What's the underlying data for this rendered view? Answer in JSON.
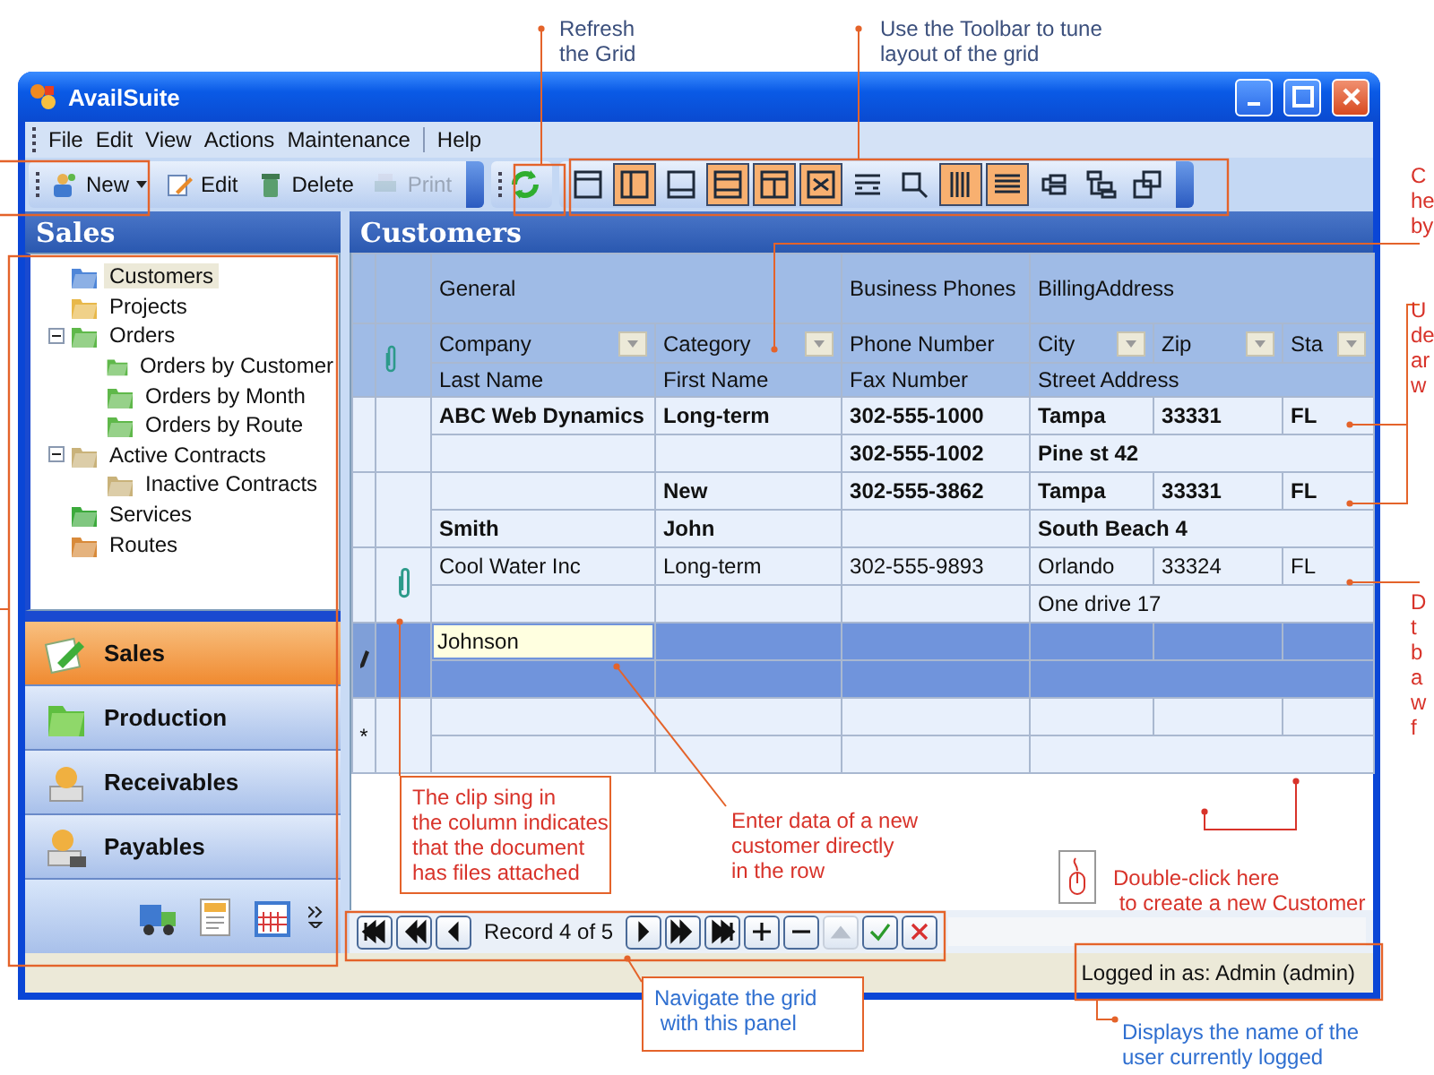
{
  "window": {
    "title": "AvailSuite"
  },
  "menu": [
    {
      "label": "File",
      "separator_before": false
    },
    {
      "label": "Edit",
      "separator_before": false
    },
    {
      "label": "View",
      "separator_before": false
    },
    {
      "label": "Actions",
      "separator_before": false
    },
    {
      "label": "Maintenance",
      "separator_before": false
    },
    {
      "label": "Help",
      "separator_before": true
    }
  ],
  "toolbar": [
    {
      "kind": "new",
      "label": "New",
      "disabled": false,
      "dropdown": true
    },
    {
      "kind": "edit",
      "label": "Edit",
      "disabled": false,
      "dropdown": false
    },
    {
      "kind": "delete",
      "label": "Delete",
      "disabled": false,
      "dropdown": false
    },
    {
      "kind": "print",
      "label": "Print",
      "disabled": true,
      "dropdown": false
    }
  ],
  "layout_tools": [
    {
      "kind": "pane-top",
      "on": false
    },
    {
      "kind": "pane-left",
      "on": true
    },
    {
      "kind": "pane-bottom",
      "on": false
    },
    {
      "kind": "pane-right",
      "on": true
    },
    {
      "kind": "split",
      "on": true
    },
    {
      "kind": "fit",
      "on": true
    },
    {
      "kind": "bands",
      "on": false
    },
    {
      "kind": "zoom",
      "on": false
    },
    {
      "kind": "vlines",
      "on": true
    },
    {
      "kind": "hlines",
      "on": true
    },
    {
      "kind": "group",
      "on": false
    },
    {
      "kind": "tree",
      "on": false
    },
    {
      "kind": "cards",
      "on": false
    }
  ],
  "sidebar": {
    "title": "Sales",
    "tree": [
      {
        "label": "Customers",
        "selected": true
      },
      {
        "label": "Projects",
        "selected": false
      },
      {
        "label": "Orders",
        "selected": false,
        "expanded": true,
        "children": [
          {
            "label": "Orders by Customer",
            "selected": false
          },
          {
            "label": "Orders by Month",
            "selected": false
          },
          {
            "label": "Orders by Route",
            "selected": false
          }
        ]
      },
      {
        "label": "Active Contracts",
        "selected": false,
        "expanded": true,
        "children": [
          {
            "label": "Inactive Contracts",
            "selected": false
          }
        ]
      },
      {
        "label": "Services",
        "selected": false
      },
      {
        "label": "Routes",
        "selected": false
      }
    ],
    "nav": [
      {
        "label": "Sales",
        "kind": "sales",
        "selected": true
      },
      {
        "label": "Production",
        "kind": "production",
        "selected": false
      },
      {
        "label": "Receivables",
        "kind": "receivables",
        "selected": false
      },
      {
        "label": "Payables",
        "kind": "payables",
        "selected": false
      }
    ],
    "overflow": [
      {
        "kind": "truck"
      },
      {
        "kind": "document"
      },
      {
        "kind": "calendar"
      }
    ]
  },
  "grid": {
    "title": "Customers",
    "groups": [
      {
        "label": "General"
      },
      {
        "label": "Business Phones"
      },
      {
        "label": "BillingAddress"
      }
    ],
    "columns_line1": [
      {
        "label": "Company",
        "filter": true
      },
      {
        "label": "Category",
        "filter": true
      },
      {
        "label": "Phone Number",
        "filter": false
      },
      {
        "label": "City",
        "filter": true
      },
      {
        "label": "Zip",
        "filter": true
      },
      {
        "label": "Sta",
        "filter": true
      }
    ],
    "columns_line2": [
      {
        "label": "Last Name"
      },
      {
        "label": "First Name"
      },
      {
        "label": "Fax Number"
      },
      {
        "label": "Street Address"
      }
    ],
    "rows": [
      {
        "kind": "record",
        "bold": true,
        "attachment": false,
        "selected": false,
        "company": "ABC Web Dynamics",
        "category": "Long-term",
        "phone": "302-555-1000",
        "city": "Tampa",
        "zip": "33331",
        "state": "FL",
        "fax": "302-555-1002",
        "street": "Pine st 42"
      },
      {
        "kind": "record",
        "bold": true,
        "attachment": false,
        "selected": false,
        "category": "New",
        "phone": "302-555-3862",
        "city": "Tampa",
        "zip": "33331",
        "state": "FL",
        "last_name": "Smith",
        "first_name": "John",
        "street": "South Beach 4"
      },
      {
        "kind": "record",
        "bold": false,
        "attachment": true,
        "selected": false,
        "company": "Cool Water Inc",
        "category": "Long-term",
        "phone": "302-555-9893",
        "city": "Orlando",
        "zip": "33324",
        "state": "FL",
        "street": "One drive 17"
      },
      {
        "kind": "editing",
        "bold": false,
        "attachment": false,
        "selected": true,
        "company": "Johnson"
      },
      {
        "kind": "new",
        "bold": false,
        "attachment": false,
        "selected": false,
        "indicator": "*"
      }
    ]
  },
  "navigator": {
    "record_text": "Record 4 of 5",
    "buttons_before": [
      {
        "kind": "first",
        "disabled": false
      },
      {
        "kind": "prev-page",
        "disabled": false
      },
      {
        "kind": "prev",
        "disabled": false
      }
    ],
    "buttons_after": [
      {
        "kind": "next",
        "disabled": false
      },
      {
        "kind": "next-page",
        "disabled": false
      },
      {
        "kind": "last",
        "disabled": false
      },
      {
        "kind": "add",
        "disabled": false
      },
      {
        "kind": "remove",
        "disabled": false
      },
      {
        "kind": "up",
        "disabled": true
      },
      {
        "kind": "apply",
        "disabled": false
      },
      {
        "kind": "cancel",
        "disabled": false
      }
    ]
  },
  "status_bar": {
    "text": "Logged in as: Admin (admin)"
  },
  "annotations": [
    {
      "text": "Refresh\nthe Grid",
      "color": "#3b4f7c",
      "boxed": false
    },
    {
      "text": "Use the Toolbar to tune\nlayout of the grid",
      "color": "#3b4f7c",
      "boxed": false
    },
    {
      "text": "C\nhe\nby",
      "color": "#d8332a",
      "boxed": false
    },
    {
      "text": "U\nde\nar\nw",
      "color": "#d8332a",
      "boxed": false
    },
    {
      "text": "D\nt\nb\na\nw\nf",
      "color": "#d8332a",
      "boxed": false
    },
    {
      "text": "The clip sing in\nthe column indicates\nthat the document\nhas files attached",
      "color": "#d8332a",
      "boxed": true
    },
    {
      "text": "Enter data of a new\ncustomer directly\nin the row",
      "color": "#d8332a",
      "boxed": false
    },
    {
      "text": "Double-click here\n to create a new Customer",
      "color": "#d8332a",
      "boxed": false
    },
    {
      "text": "Navigate the grid\n with this panel",
      "color": "#2f6fd0",
      "boxed": true
    },
    {
      "text": "Displays the name of the\nuser currently logged",
      "color": "#2f6fd0",
      "boxed": false
    }
  ]
}
